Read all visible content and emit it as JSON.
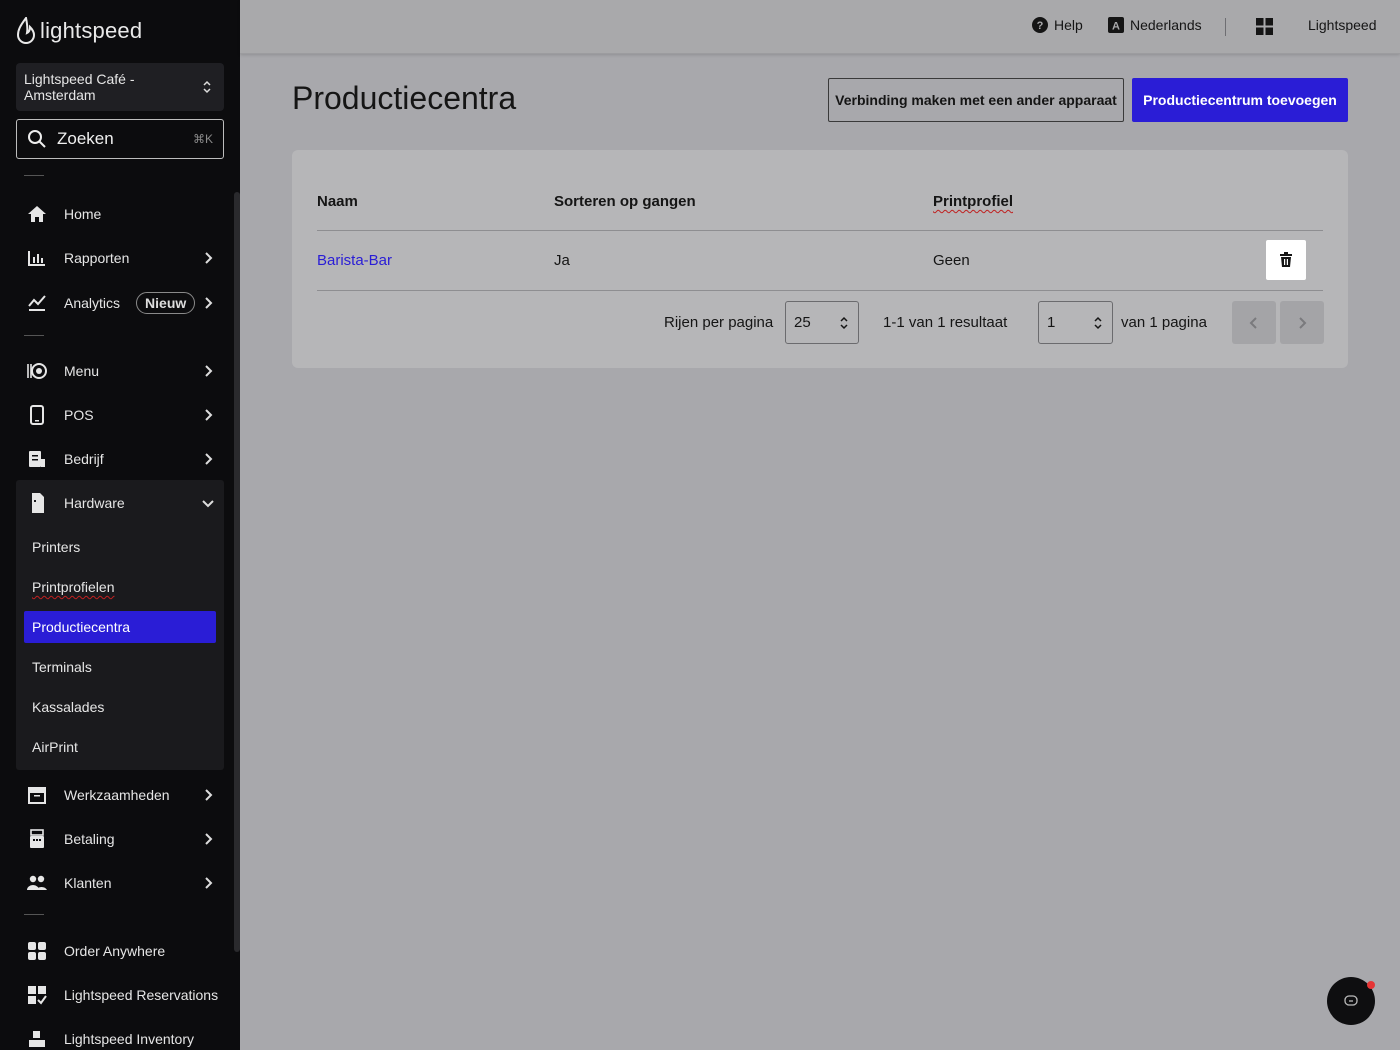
{
  "app": {
    "brand": "lightspeed",
    "accent_color": "#2a1dd6"
  },
  "sidebar": {
    "store": "Lightspeed Café - Amsterdam",
    "search_placeholder": "Zoeken",
    "search_shortcut": "⌘K",
    "nav_top": [
      {
        "label": "Home",
        "icon": "home-icon"
      },
      {
        "label": "Rapporten",
        "icon": "bar-chart-icon"
      },
      {
        "label": "Analytics",
        "icon": "analytics-icon",
        "badge": "Nieuw"
      }
    ],
    "nav_mid": [
      {
        "label": "Menu",
        "icon": "menu-icon"
      },
      {
        "label": "POS",
        "icon": "tablet-icon"
      },
      {
        "label": "Bedrijf",
        "icon": "business-icon"
      },
      {
        "label": "Hardware",
        "icon": "hardware-icon"
      }
    ],
    "hardware_items": [
      "Printers",
      "Printprofielen",
      "Productiecentra",
      "Terminals",
      "Kassalades",
      "AirPrint"
    ],
    "nav_low": [
      {
        "label": "Werkzaamheden",
        "icon": "archive-icon"
      },
      {
        "label": "Betaling",
        "icon": "register-icon"
      },
      {
        "label": "Klanten",
        "icon": "people-icon"
      }
    ],
    "nav_bottom": [
      {
        "label": "Order Anywhere",
        "icon": "order-anywhere-icon"
      },
      {
        "label": "Lightspeed Reservations",
        "icon": "reservations-icon"
      },
      {
        "label": "Lightspeed Inventory",
        "icon": "inventory-icon"
      }
    ]
  },
  "topbar": {
    "help": "Help",
    "language": "Nederlands",
    "account": "Lightspeed"
  },
  "main": {
    "title": "Productiecentra",
    "btn_connect": "Verbinding maken met een ander apparaat",
    "btn_add": "Productiecentrum toevoegen",
    "table": {
      "columns": [
        "Naam",
        "Sorteren op gangen",
        "Printprofiel"
      ],
      "rows": [
        {
          "naam": "Barista-Bar",
          "sorteren": "Ja",
          "printprofiel": "Geen"
        }
      ]
    },
    "pagination": {
      "rows_label": "Rijen per pagina",
      "rows_value": "25",
      "result_text": "1-1 van 1 resultaat",
      "page_value": "1",
      "page_total_text": "van 1 pagina"
    }
  }
}
